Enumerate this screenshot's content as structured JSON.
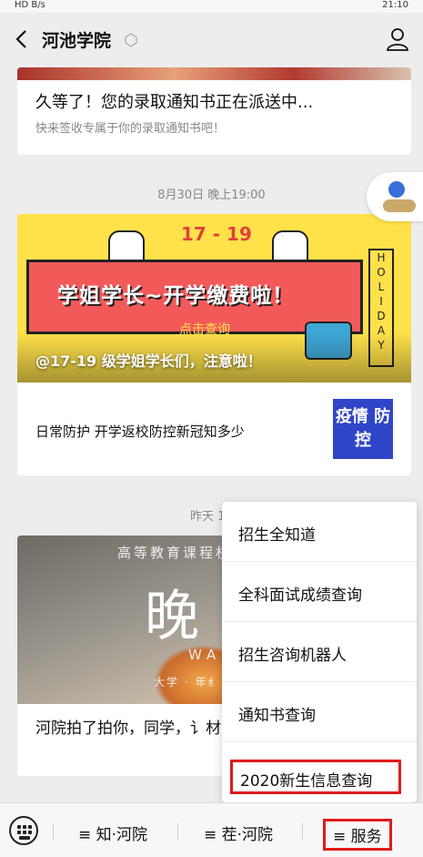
{
  "status_bar": {
    "left_text": "HD  B/s",
    "right_text": "21:10"
  },
  "header": {
    "title": "河池学院",
    "back_icon": "chevron-left-icon",
    "user_icon": "user-profile-icon"
  },
  "messages": [
    {
      "title": "久等了！您的录取通知书正在派送中...",
      "subtitle": "快来签收专属于你的录取通知书吧！"
    },
    {
      "time": "8月30日 晚上19:00",
      "banner": {
        "year": "17 - 19",
        "headline": "学姐学长~开学缴费啦！",
        "click": "点击查询",
        "holiday": "HOLIDAY",
        "caption": "@17-19 级学姐学长们，注意啦！"
      },
      "item": "日常防护 开学返校防控新冠知多少",
      "thumb": "疫情 防控"
    },
    {
      "time": "昨天 18",
      "photo": {
        "line1": "高等教育课程权",
        "line2": "晚",
        "line3": "WAN",
        "line4": "大学 · 年纟"
      },
      "caption": "河院拍了拍你，同学，讠材”~"
    }
  ],
  "menu": {
    "items": [
      "招生全知道",
      "全科面试成绩查询",
      "招生咨询机器人",
      "通知书查询",
      "2020新生信息查询"
    ]
  },
  "bottom_bar": {
    "tabs": [
      "≡ 知·河院",
      "≡ 茬·河院",
      "≡ 服务"
    ],
    "keyboard_icon": "keyboard-icon"
  },
  "colors": {
    "accent_red": "#e01b1b",
    "banner_yellow": "#ffe14a",
    "thumb_blue": "#2f46c8"
  }
}
